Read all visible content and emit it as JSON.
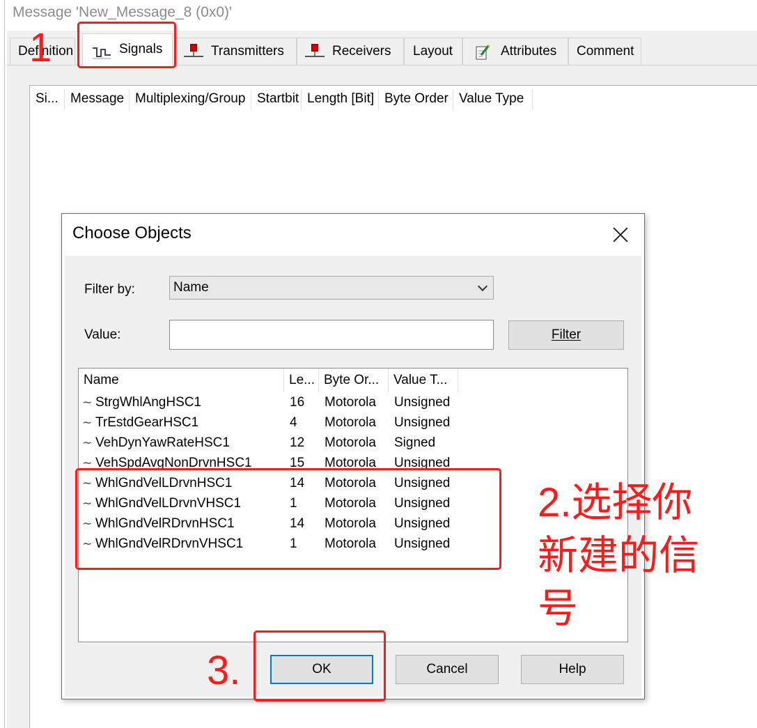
{
  "window": {
    "title": "Message 'New_Message_8 (0x0)'"
  },
  "tabs": [
    {
      "label": "Definition"
    },
    {
      "label": "Signals"
    },
    {
      "label": "Transmitters"
    },
    {
      "label": "Receivers"
    },
    {
      "label": "Layout"
    },
    {
      "label": "Attributes"
    },
    {
      "label": "Comment"
    }
  ],
  "signals_table": {
    "columns": [
      "Si...",
      "Message",
      "Multiplexing/Group",
      "Startbit",
      "Length [Bit]",
      "Byte Order",
      "Value Type"
    ]
  },
  "dialog": {
    "title": "Choose Objects",
    "filter_by_label": "Filter by:",
    "filter_by_value": "Name",
    "value_label": "Value:",
    "value_input": "",
    "filter_button": "Filter",
    "list": {
      "columns": [
        "Name",
        "Le...",
        "Byte Or...",
        "Value T..."
      ],
      "rows": [
        {
          "name": "StrgWhlAngHSC1",
          "length": "16",
          "byte_order": "Motorola",
          "value_type": "Unsigned"
        },
        {
          "name": "TrEstdGearHSC1",
          "length": "4",
          "byte_order": "Motorola",
          "value_type": "Unsigned"
        },
        {
          "name": "VehDynYawRateHSC1",
          "length": "12",
          "byte_order": "Motorola",
          "value_type": "Signed"
        },
        {
          "name": "VehSpdAvgNonDrvnHSC1",
          "length": "15",
          "byte_order": "Motorola",
          "value_type": "Unsigned"
        },
        {
          "name": "WhlGndVelLDrvnHSC1",
          "length": "14",
          "byte_order": "Motorola",
          "value_type": "Unsigned"
        },
        {
          "name": "WhlGndVelLDrvnVHSC1",
          "length": "1",
          "byte_order": "Motorola",
          "value_type": "Unsigned"
        },
        {
          "name": "WhlGndVelRDrvnHSC1",
          "length": "14",
          "byte_order": "Motorola",
          "value_type": "Unsigned"
        },
        {
          "name": "WhlGndVelRDrvnVHSC1",
          "length": "1",
          "byte_order": "Motorola",
          "value_type": "Unsigned"
        }
      ]
    },
    "buttons": {
      "ok": "OK",
      "cancel": "Cancel",
      "help": "Help"
    }
  },
  "annotations": {
    "step1": "1",
    "step2": "2.选择你新建的信号",
    "step3": "3.",
    "color": "#ff1a1a"
  }
}
